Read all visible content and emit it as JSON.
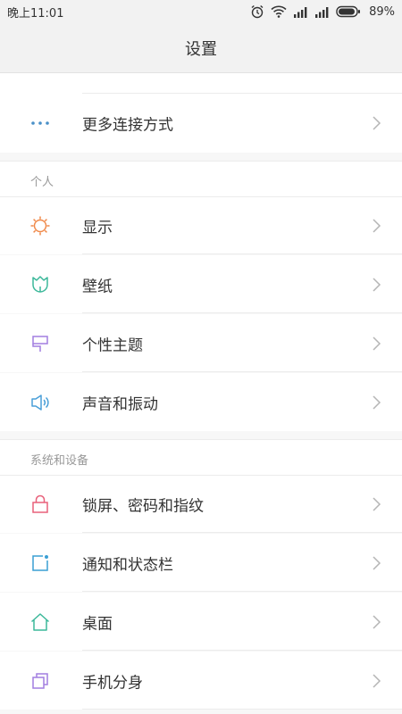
{
  "status_bar": {
    "time": "晚上11:01",
    "battery_pct": "89%",
    "icons": [
      "alarm-icon",
      "wifi-icon",
      "signal-icon",
      "signal-icon",
      "battery-icon"
    ]
  },
  "header": {
    "title": "设置"
  },
  "top_group": {
    "items": [
      {
        "label": "更多连接方式",
        "icon": "more-dots-icon",
        "icon_color": "#4a90c8"
      }
    ]
  },
  "sections": [
    {
      "title": "个人",
      "items": [
        {
          "label": "显示",
          "icon": "sun-icon",
          "icon_color": "#f08a4b"
        },
        {
          "label": "壁纸",
          "icon": "tulip-icon",
          "icon_color": "#3cb89a"
        },
        {
          "label": "个性主题",
          "icon": "brush-icon",
          "icon_color": "#a27ee0"
        },
        {
          "label": "声音和振动",
          "icon": "speaker-icon",
          "icon_color": "#4a9fd8"
        }
      ]
    },
    {
      "title": "系统和设备",
      "items": [
        {
          "label": "锁屏、密码和指纹",
          "icon": "lock-icon",
          "icon_color": "#e8607a"
        },
        {
          "label": "通知和状态栏",
          "icon": "notification-icon",
          "icon_color": "#3a9fd4"
        },
        {
          "label": "桌面",
          "icon": "home-icon",
          "icon_color": "#3cb89a"
        },
        {
          "label": "手机分身",
          "icon": "dual-icon",
          "icon_color": "#a27ee0"
        }
      ]
    }
  ]
}
